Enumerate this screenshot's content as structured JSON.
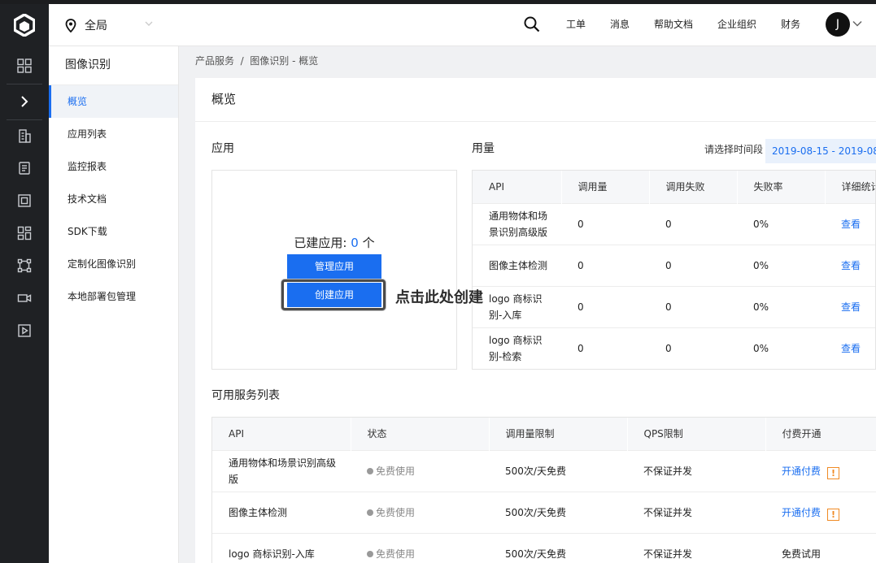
{
  "header": {
    "region": "全局",
    "nav": [
      "工单",
      "消息",
      "帮助文档",
      "企业组织",
      "财务"
    ],
    "avatar": "J"
  },
  "rail": {
    "icons": [
      "logo-icon",
      "grid-icon",
      "expand-chevron-icon",
      "building-icon",
      "document-icon",
      "frame-icon",
      "apps-icon",
      "nodes-icon",
      "camera-icon",
      "play-icon"
    ]
  },
  "sidebar": {
    "title": "图像识别",
    "items": [
      {
        "label": "概览",
        "active": true
      },
      {
        "label": "应用列表"
      },
      {
        "label": "监控报表"
      },
      {
        "label": "技术文档"
      },
      {
        "label": "SDK下载"
      },
      {
        "label": "定制化图像识别"
      },
      {
        "label": "本地部署包管理"
      }
    ]
  },
  "breadcrumb": "产品服务  /  图像识别 - 概览",
  "main": {
    "title": "概览",
    "apps": {
      "heading": "应用",
      "count_prefix": "已建应用: ",
      "count": "0",
      "count_suffix": " 个",
      "manage_label": "管理应用",
      "create_label": "创建应用",
      "hint": "点击此处创建"
    },
    "usage": {
      "heading": "用量",
      "range_label": "请选择时间段",
      "range_value": "2019-08-15 - 2019-08",
      "columns": [
        "API",
        "调用量",
        "调用失败",
        "失败率",
        "详细统计"
      ],
      "rows": [
        {
          "api": "通用物体和场景识别高级版",
          "calls": "0",
          "fails": "0",
          "rate": "0%",
          "action": "查看"
        },
        {
          "api": "图像主体检测",
          "calls": "0",
          "fails": "0",
          "rate": "0%",
          "action": "查看"
        },
        {
          "api": "logo 商标识别-入库",
          "calls": "0",
          "fails": "0",
          "rate": "0%",
          "action": "查看"
        },
        {
          "api": "logo 商标识别-检索",
          "calls": "0",
          "fails": "0",
          "rate": "0%",
          "action": "查看"
        }
      ]
    },
    "services": {
      "heading": "可用服务列表",
      "columns": [
        "API",
        "状态",
        "调用量限制",
        "QPS限制",
        "付费开通"
      ],
      "rows": [
        {
          "api": "通用物体和场景识别高级版",
          "status": "免费使用",
          "limit": "500次/天免费",
          "qps": "不保证并发",
          "pay": "开通付费",
          "warn": "!"
        },
        {
          "api": "图像主体检测",
          "status": "免费使用",
          "limit": "500次/天免费",
          "qps": "不保证并发",
          "pay": "开通付费",
          "warn": "!"
        },
        {
          "api": "logo 商标识别-入库",
          "status": "免费使用",
          "limit": "500次/天免费",
          "qps": "不保证并发",
          "pay": "免费试用",
          "warn": ""
        }
      ]
    }
  }
}
